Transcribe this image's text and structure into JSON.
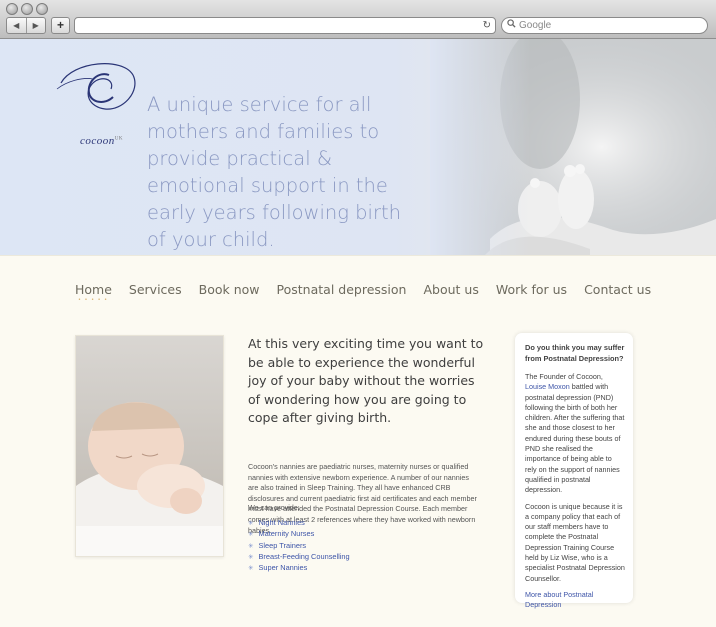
{
  "browser": {
    "back_label": "◀",
    "forward_label": "▶",
    "new_tab_label": "+",
    "reload_icon": "↻",
    "search_placeholder": "Google"
  },
  "hero": {
    "logo_text": "cocoon",
    "logo_suffix": "UK",
    "tagline": "A unique service for all mothers and families to provide practical & emotional support in the early years following birth of your child."
  },
  "nav": {
    "items": [
      "Home",
      "Services",
      "Book now",
      "Postnatal depression",
      "About us",
      "Work for us",
      "Contact us"
    ],
    "active": "Home"
  },
  "main": {
    "lead": "At this very exciting time you want to be able to experience the wonderful joy of your baby without the worries of wondering how you are going to cope after giving birth.",
    "body": "Cocoon's nannies are paediatric nurses, maternity nurses or qualified nannies with extensive newborn experience. A number of our nannies are also trained in Sleep Training. They all have enhanced CRB disclosures and current paediatric first aid certificates and each member must have attended the Postnatal Depression Course. Each member comes with at least 2 references where they have worked with newborn babies.",
    "provide_intro": "We can provide:",
    "provide_items": [
      "Night Nannies",
      "Maternity Nurses",
      "Sleep Trainers",
      "Breast-Feeding Counselling",
      "Super Nannies"
    ]
  },
  "sidebar": {
    "heading": "Do you think you may suffer from Postnatal Depression?",
    "p1_before": "The Founder of Cocoon, ",
    "p1_link": "Louise Moxon",
    "p1_after": " battled with postnatal depression (PND) following the birth of both her children. After the suffering that she and those closest to her endured during these bouts of PND she realised the importance of being able to rely on the support of nannies qualified in postnatal depression.",
    "p2": "Cocoon is unique because it is a company policy that each of our staff members have to complete the Postnatal Depression Training Course held by Liz Wise, who is a specialist Postnatal Depression Counsellor.",
    "more_link": "More about Postnatal Depression"
  },
  "colors": {
    "hero_bg": "#dde6f5",
    "tagline": "#8a98c2",
    "link": "#3e55a8",
    "nav_active_dots": "#d8b06c",
    "page_bg": "#fcfaf2"
  }
}
